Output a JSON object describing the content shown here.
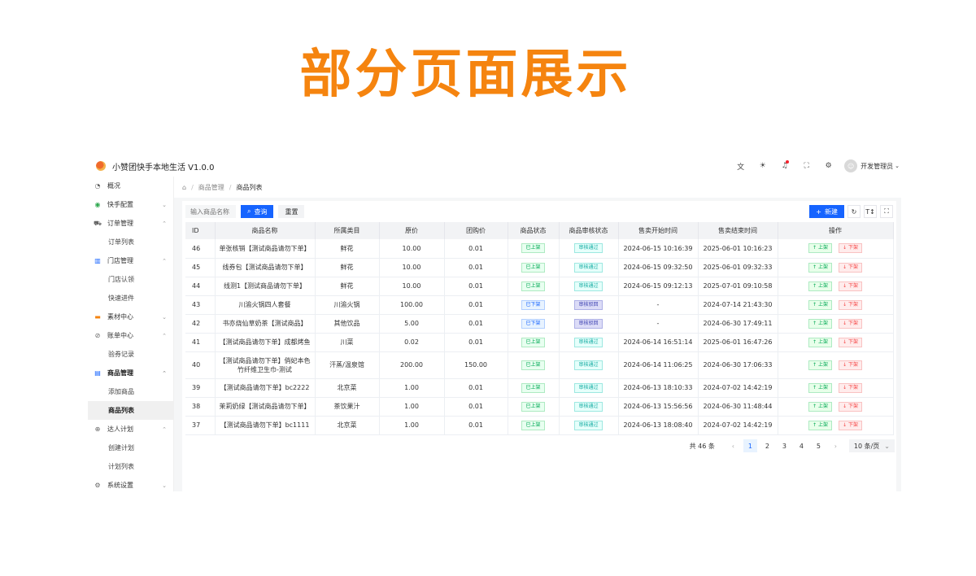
{
  "banner": {
    "title": "部分页面展示"
  },
  "app": {
    "title": "小赞团快手本地生活 V1.0.0",
    "user": "开发管理员",
    "top_icons": [
      "translate-icon",
      "theme-icon",
      "bell-icon",
      "fullscreen-icon",
      "settings-icon"
    ]
  },
  "sidebar": {
    "items": [
      {
        "label": "概况",
        "icon": "dashboard-icon",
        "chevron": ""
      },
      {
        "label": "快手配置",
        "icon": "kuaishou-icon",
        "chevron": "⌄"
      },
      {
        "label": "订单管理",
        "icon": "order-icon",
        "chevron": "⌃"
      },
      {
        "label": "订单列表",
        "sub": true
      },
      {
        "label": "门店管理",
        "icon": "store-icon",
        "chevron": "⌃"
      },
      {
        "label": "门店认领",
        "sub": true
      },
      {
        "label": "快速进件",
        "sub": true
      },
      {
        "label": "素材中心",
        "icon": "material-icon",
        "chevron": "⌄"
      },
      {
        "label": "账单中心",
        "icon": "bill-icon",
        "chevron": "⌃"
      },
      {
        "label": "验券记录",
        "sub": true
      },
      {
        "label": "商品管理",
        "icon": "goods-icon",
        "chevron": "⌃",
        "open": true
      },
      {
        "label": "添加商品",
        "sub": true
      },
      {
        "label": "商品列表",
        "sub": true,
        "active": true
      },
      {
        "label": "达人计划",
        "icon": "talent-icon",
        "chevron": "⌃"
      },
      {
        "label": "创建计划",
        "sub": true
      },
      {
        "label": "计划列表",
        "sub": true
      },
      {
        "label": "系统设置",
        "icon": "system-icon",
        "chevron": "⌄"
      }
    ]
  },
  "breadcrumb": {
    "level1": "商品管理",
    "level2": "商品列表"
  },
  "toolbar": {
    "search_placeholder": "输入商品名称",
    "query_label": "查询",
    "reset_label": "重置",
    "new_label": "新建"
  },
  "table": {
    "headers": [
      "ID",
      "商品名称",
      "所属类目",
      "原价",
      "团购价",
      "商品状态",
      "商品审核状态",
      "售卖开始时间",
      "售卖结束时间",
      "操作"
    ],
    "op_up": "上架",
    "op_down": "下架",
    "rows": [
      {
        "id": "46",
        "name": "单张核销【测试商品请勿下单】",
        "cat": "鲜花",
        "price": "10.00",
        "group": "0.01",
        "status": "已上架",
        "audit": "审核通过",
        "start": "2024-06-15 10:16:39",
        "end": "2025-06-01 10:16:23"
      },
      {
        "id": "45",
        "name": "线券包【测试商品请勿下单】",
        "cat": "鲜花",
        "price": "10.00",
        "group": "0.01",
        "status": "已上架",
        "audit": "审核通过",
        "start": "2024-06-15 09:32:50",
        "end": "2025-06-01 09:32:33"
      },
      {
        "id": "44",
        "name": "线测1【测试商品请勿下单】",
        "cat": "鲜花",
        "price": "10.00",
        "group": "0.01",
        "status": "已上架",
        "audit": "审核通过",
        "start": "2024-06-15 09:12:13",
        "end": "2025-07-01 09:10:58"
      },
      {
        "id": "43",
        "name": "川渝火锅四人套餐",
        "cat": "川渝火锅",
        "price": "100.00",
        "group": "0.01",
        "status": "已下架",
        "audit": "审核驳回",
        "start": "-",
        "end": "2024-07-14 21:43:30"
      },
      {
        "id": "42",
        "name": "书亦烧仙草奶茶【测试商品】",
        "cat": "其他饮品",
        "price": "5.00",
        "group": "0.01",
        "status": "已下架",
        "audit": "审核驳回",
        "start": "-",
        "end": "2024-06-30 17:49:11"
      },
      {
        "id": "41",
        "name": "【测试商品请勿下单】成都烤鱼",
        "cat": "川菜",
        "price": "0.02",
        "group": "0.01",
        "status": "已上架",
        "audit": "审核通过",
        "start": "2024-06-14 16:51:14",
        "end": "2025-06-01 16:47:26"
      },
      {
        "id": "40",
        "name": "【测试商品请勿下单】俏妃本色竹纤维卫生巾-测试",
        "cat": "汗蒸/温泉馆",
        "price": "200.00",
        "group": "150.00",
        "status": "已上架",
        "audit": "审核通过",
        "start": "2024-06-14 11:06:25",
        "end": "2024-06-30 17:06:33",
        "tall": true
      },
      {
        "id": "39",
        "name": "【测试商品请勿下单】bc2222",
        "cat": "北京菜",
        "price": "1.00",
        "group": "0.01",
        "status": "已上架",
        "audit": "审核通过",
        "start": "2024-06-13 18:10:33",
        "end": "2024-07-02 14:42:19"
      },
      {
        "id": "38",
        "name": "茉莉奶绿【测试商品请勿下单】",
        "cat": "茶饮果汁",
        "price": "1.00",
        "group": "0.01",
        "status": "已上架",
        "audit": "审核通过",
        "start": "2024-06-13 15:56:56",
        "end": "2024-06-30 11:48:44"
      },
      {
        "id": "37",
        "name": "【测试商品请勿下单】bc1111",
        "cat": "北京菜",
        "price": "1.00",
        "group": "0.01",
        "status": "已上架",
        "audit": "审核通过",
        "start": "2024-06-13 18:08:40",
        "end": "2024-07-02 14:42:19"
      }
    ]
  },
  "pager": {
    "total": "共 46 条",
    "pages": [
      "1",
      "2",
      "3",
      "4",
      "5"
    ],
    "current": "1",
    "page_size": "10 条/页"
  }
}
